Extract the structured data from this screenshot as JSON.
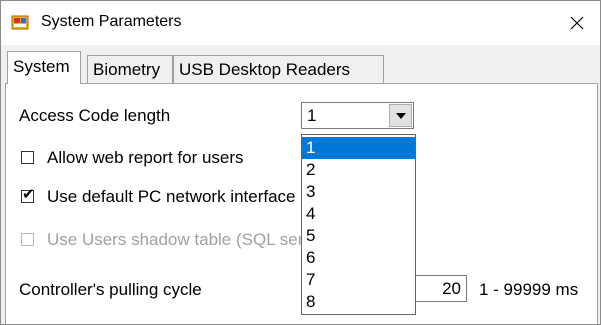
{
  "window": {
    "title": "System Parameters",
    "app_icon": "system-parameters-app-icon",
    "close_icon": "close-icon"
  },
  "tabs": [
    {
      "label": "System",
      "active": true
    },
    {
      "label": "Biometry",
      "active": false
    },
    {
      "label": "USB Desktop Readers",
      "active": false
    }
  ],
  "system": {
    "access_code_label": "Access Code length",
    "access_code_value": "1",
    "access_code_options": [
      "1",
      "2",
      "3",
      "4",
      "5",
      "6",
      "7",
      "8"
    ],
    "access_code_selected_index": 0,
    "allow_web_report_label": "Allow web report for users",
    "allow_web_report_checked": false,
    "use_default_network_label": "Use default PC network interface",
    "use_default_network_checked": true,
    "use_shadow_table_label": "Use Users shadow table (SQL server only)",
    "use_shadow_table_checked": false,
    "use_shadow_table_enabled": false,
    "pulling_cycle_label": "Controller's pulling cycle",
    "pulling_cycle_value": "20",
    "pulling_cycle_range": "1 - 99999 ms"
  },
  "colors": {
    "selection": "#0078d7",
    "disabled_text": "#a0a0a0"
  }
}
